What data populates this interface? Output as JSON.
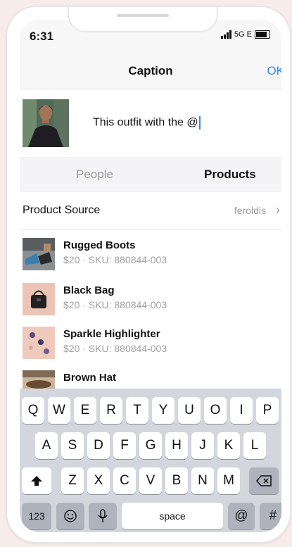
{
  "status": {
    "time": "6:31",
    "network": "5G E"
  },
  "nav": {
    "title": "Caption",
    "ok": "OK"
  },
  "caption": {
    "text": "This outfit with the @"
  },
  "tabs": {
    "people": "People",
    "products": "Products"
  },
  "source": {
    "label": "Product Source",
    "value": "feroldis"
  },
  "products": [
    {
      "name": "Rugged Boots",
      "meta": "$20 · SKU: 880844-003"
    },
    {
      "name": "Black Bag",
      "meta": "$20 · SKU: 880844-003"
    },
    {
      "name": "Sparkle Highlighter",
      "meta": "$20 · SKU: 880844-003"
    },
    {
      "name": "Brown Hat",
      "meta": ""
    }
  ],
  "keyboard": {
    "row1": [
      "Q",
      "W",
      "E",
      "R",
      "T",
      "Y",
      "U",
      "O",
      "I",
      "P"
    ],
    "row2": [
      "A",
      "S",
      "D",
      "F",
      "G",
      "H",
      "J",
      "K",
      "L"
    ],
    "row3": [
      "Z",
      "X",
      "C",
      "V",
      "B",
      "N",
      "M"
    ],
    "numbers": "123",
    "space": "space",
    "at": "@",
    "hash": "#"
  },
  "colors": {
    "accent": "#2f8cf6",
    "page_background": "#f8ecea"
  }
}
